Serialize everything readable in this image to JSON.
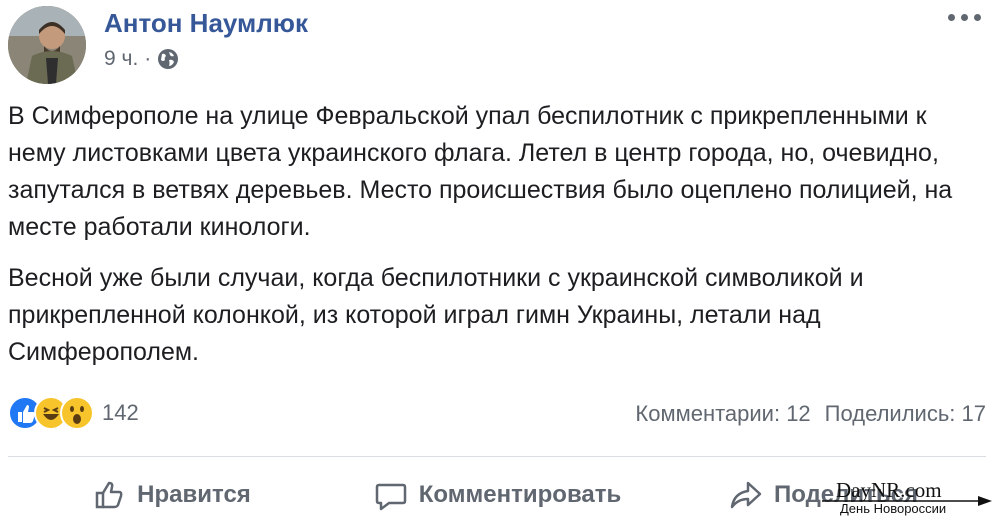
{
  "post": {
    "author": "Антон Наумлюк",
    "time": "9 ч.",
    "meta_separator": "·",
    "paragraphs": [
      "В Симферополе на улице Февральской упал беспилотник с прикрепленными к нему листовками цвета украинского флага. Летел в центр города, но, очевидно, запутался в ветвях деревьев. Место происшествия было оцеплено полицией, на месте работали кинологи.",
      "Весной уже были случаи, когда беспилотники с украинской символикой и прикрепленной колонкой, из которой играл гимн Украины, летали над Симферополем."
    ]
  },
  "reactions": {
    "icons": [
      "like-icon",
      "haha-icon",
      "wow-icon"
    ],
    "count": "142"
  },
  "counts": {
    "comments": "Комментарии: 12",
    "shares": "Поделились: 17"
  },
  "actions": {
    "like": "Нравится",
    "comment": "Комментировать",
    "share": "Поделиться"
  },
  "watermark": {
    "main": "DayNR.com",
    "sub": "День Новороссии"
  },
  "colors": {
    "author_link": "#365899",
    "meta_text": "#616770",
    "like_blue": "#2078f4",
    "emoji_yellow": "#f7c42c"
  }
}
